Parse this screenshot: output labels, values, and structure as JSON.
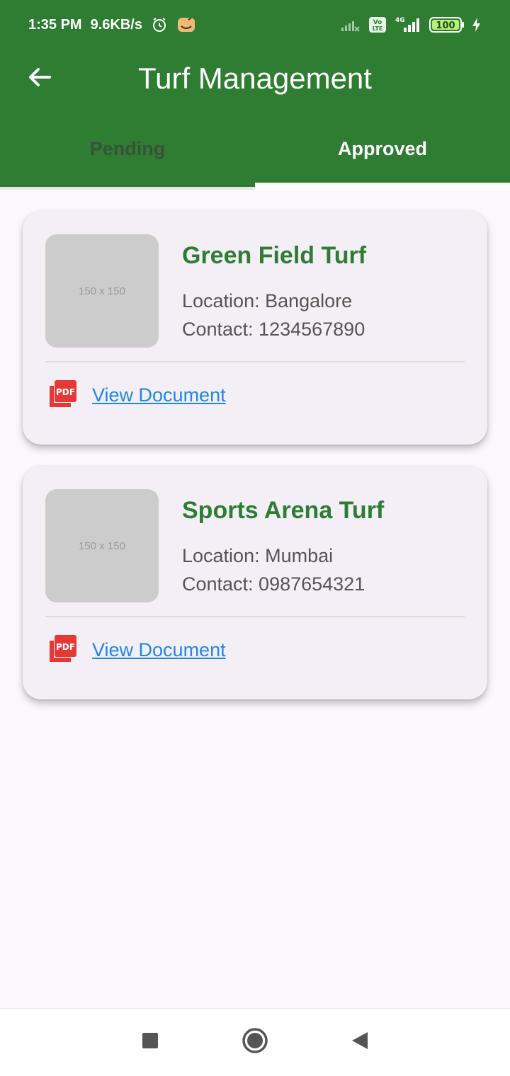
{
  "status_bar": {
    "time": "1:35 PM",
    "speed": "9.6KB/s",
    "battery": "100",
    "icons": [
      "alarm-icon",
      "app-notification-icon",
      "signal-icon",
      "volte-icon",
      "signal-4g-icon",
      "battery-icon",
      "charging-icon"
    ],
    "network_4g": "4G",
    "volte_text": "Vo LTE"
  },
  "app_bar": {
    "title": "Turf Management",
    "back_icon": "back-arrow-icon"
  },
  "tabs": [
    {
      "label": "Pending",
      "selected": false
    },
    {
      "label": "Approved",
      "selected": true
    }
  ],
  "turfs": [
    {
      "name": "Green Field Turf",
      "location": "Location: Bangalore",
      "contact": "Contact: 1234567890",
      "image_placeholder": "150 x 150",
      "document_link": "View Document",
      "doc_icon": "pdf-icon"
    },
    {
      "name": "Sports Arena Turf",
      "location": "Location: Mumbai",
      "contact": "Contact: 0987654321",
      "image_placeholder": "150 x 150",
      "document_link": "View Document",
      "doc_icon": "pdf-icon"
    }
  ],
  "nav_bar": {
    "icons": [
      "recents-square-icon",
      "home-circle-icon",
      "back-triangle-icon"
    ]
  },
  "colors": {
    "primary": "#2e7d32",
    "link": "#1e88e5",
    "pdf": "#e53935",
    "background": "#fcf6fd"
  }
}
